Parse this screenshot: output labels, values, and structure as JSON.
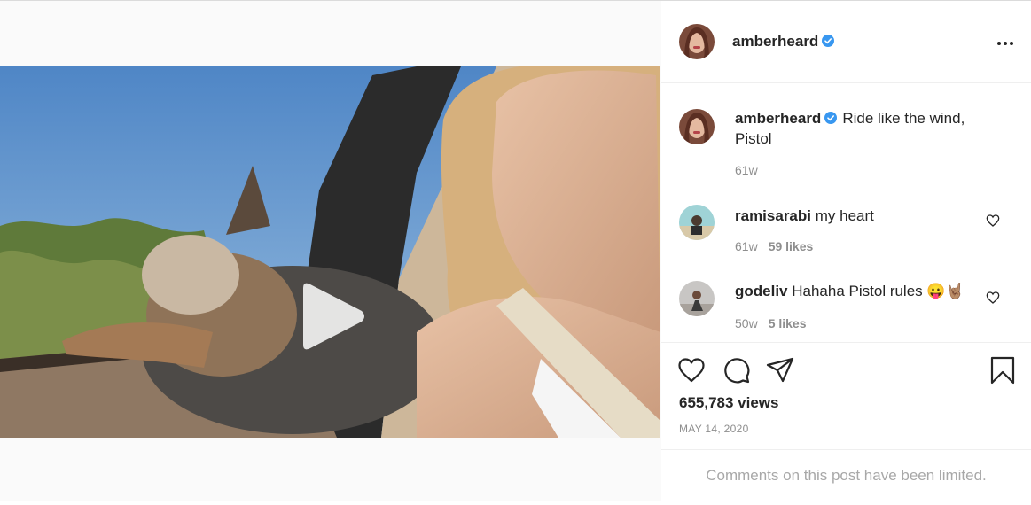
{
  "post": {
    "author": "amberheard",
    "caption": "Ride like the wind, Pistol",
    "caption_age": "61w",
    "views": "655,783 views",
    "date": "MAY 14, 2020",
    "comments_limited": "Comments on this post have been limited."
  },
  "comments": [
    {
      "user": "ramisarabi",
      "text": "my heart",
      "age": "61w",
      "likes": "59 likes"
    },
    {
      "user": "godeliv",
      "text": "Hahaha Pistol rules 😛🤘🏽",
      "age": "50w",
      "likes": "5 likes"
    }
  ],
  "colors": {
    "verified": "#3897f0",
    "text": "#262626",
    "muted": "#8e8e8e"
  },
  "icons": [
    "verified-icon",
    "more-icon",
    "heart-icon",
    "comment-icon",
    "share-icon",
    "bookmark-icon",
    "play-icon",
    "mute-icon"
  ]
}
